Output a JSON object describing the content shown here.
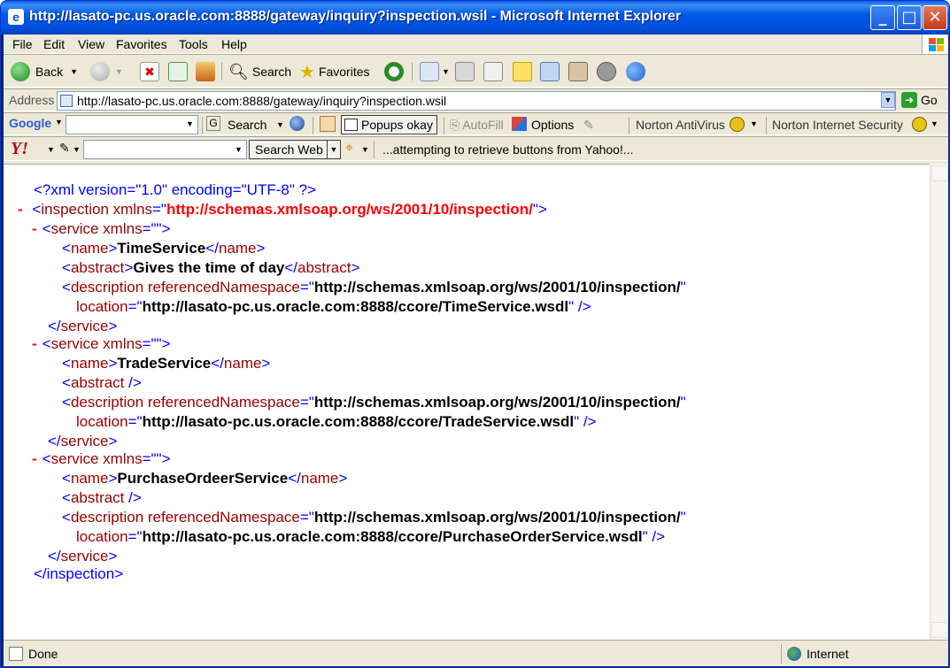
{
  "window": {
    "title": "http://lasato-pc.us.oracle.com:8888/gateway/inquiry?inspection.wsil - Microsoft Internet Explorer"
  },
  "menu": [
    "File",
    "Edit",
    "View",
    "Favorites",
    "Tools",
    "Help"
  ],
  "toolbar": {
    "back": "Back",
    "search": "Search",
    "favorites": "Favorites"
  },
  "address": {
    "label": "Address",
    "url": "http://lasato-pc.us.oracle.com:8888/gateway/inquiry?inspection.wsil",
    "go": "Go"
  },
  "google": {
    "logo": "Google",
    "search": "Search",
    "popups": "Popups okay",
    "autofill": "AutoFill",
    "options": "Options",
    "nav": "Norton AntiVirus",
    "nis": "Norton Internet Security"
  },
  "yahoo": {
    "logo": "Y!",
    "search_web": "Search Web",
    "status": "...attempting to retrieve buttons from Yahoo!..."
  },
  "xml": {
    "decl": "<?xml version=\"1.0\" encoding=\"UTF-8\" ?>",
    "root_open_pre": "<",
    "root_tag": "inspection",
    "root_attr": " xmlns",
    "eq": "=\"",
    "root_ns": "http://schemas.xmlsoap.org/ws/2001/10/inspection/",
    "root_close_q": "\">",
    "root_end": "</inspection>",
    "services": [
      {
        "name": "TimeService",
        "abstract": "Gives the time of day",
        "ns": "http://schemas.xmlsoap.org/ws/2001/10/inspection/",
        "location": "http://lasato-pc.us.oracle.com:8888/ccore/TimeService.wsdl"
      },
      {
        "name": "TradeService",
        "abstract": "",
        "ns": "http://schemas.xmlsoap.org/ws/2001/10/inspection/",
        "location": "http://lasato-pc.us.oracle.com:8888/ccore/TradeService.wsdl"
      },
      {
        "name": "PurchaseOrdeerService",
        "abstract": "",
        "ns": "http://schemas.xmlsoap.org/ws/2001/10/inspection/",
        "location": "http://lasato-pc.us.oracle.com:8888/ccore/PurchaseOrderService.wsdl"
      }
    ]
  },
  "status": {
    "text": "Done",
    "zone": "Internet"
  }
}
